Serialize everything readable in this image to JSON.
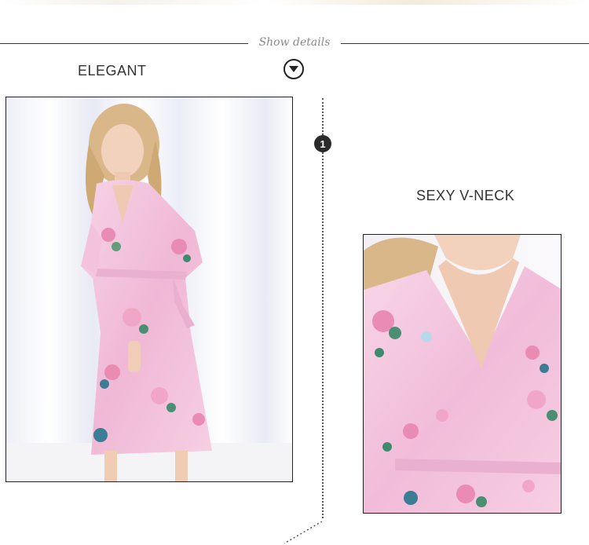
{
  "header": {
    "show_details": "Show details",
    "toggle_icon": "chevron-down-circle-icon"
  },
  "sections": [
    {
      "label": "ELEGANT",
      "image": "woman in pink floral peacock-print satin kimono robe"
    },
    {
      "label": "SEXY V-NECK",
      "image": "close-up of pink floral satin robe v-neck"
    }
  ],
  "marker": {
    "number": "1"
  },
  "colors": {
    "robe_pink": "#f3c2dc",
    "rule": "#333333",
    "muted_text": "#8a8a8a"
  }
}
